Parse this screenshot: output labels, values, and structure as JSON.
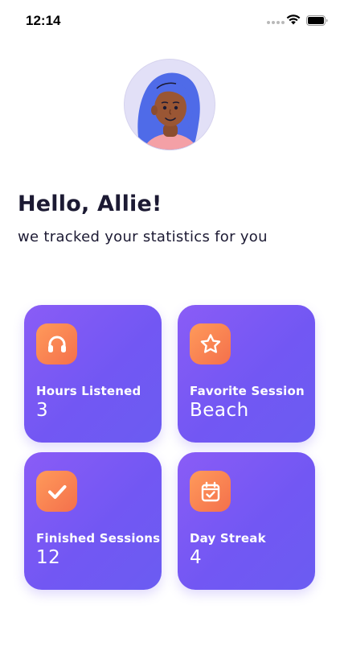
{
  "status_bar": {
    "time": "12:14",
    "icons": [
      "signal-icon",
      "wifi-icon",
      "battery-icon"
    ]
  },
  "profile": {
    "avatar": "avatar-illustration"
  },
  "greeting": {
    "title": "Hello, Allie!",
    "subtitle": "we tracked your statistics for you"
  },
  "stats": [
    {
      "icon": "headphones-icon",
      "label": "Hours Listened",
      "value": "3"
    },
    {
      "icon": "star-icon",
      "label": "Favorite Session",
      "value": "Beach"
    },
    {
      "icon": "check-icon",
      "label": "Finished Sessions",
      "value": "12"
    },
    {
      "icon": "calendar-check-icon",
      "label": "Day Streak",
      "value": "4"
    }
  ],
  "colors": {
    "card_gradient_start": "#8a5cf6",
    "card_gradient_end": "#6b5cf2",
    "icon_gradient_start": "#ff9a5a",
    "icon_gradient_end": "#f4704c",
    "text_dark": "#1c1a33",
    "avatar_bg": "#e2e0f7"
  }
}
